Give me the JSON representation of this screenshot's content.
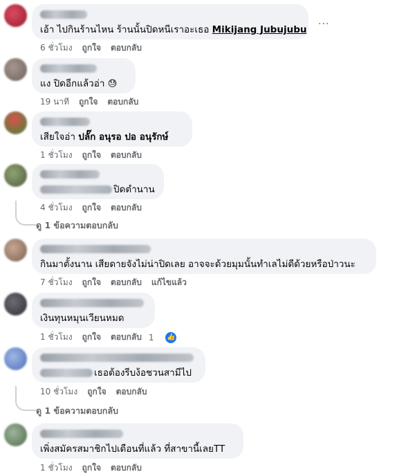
{
  "comments": [
    {
      "text_pre": "เอ้า ไปกินร้านไหน ร้านนั้นปิดหนีเราอะเธอ ",
      "tag": "Mikijang Jubujubu",
      "time": "6 ชั่วโมง",
      "like": "ถูกใจ",
      "reply": "ตอบกลับ",
      "more": "···",
      "avatar_color": "#b3243a"
    },
    {
      "text": "แง ปิดอีกแล้วอ่า",
      "emoji": "😓",
      "time": "19 นาที",
      "like": "ถูกใจ",
      "reply": "ตอบกลับ",
      "avatar_color": "#8a7c78"
    },
    {
      "text_pre": "เสียใจอ่า ",
      "tag": "ปลั๊ก อนุรอ ปอ อนุรักษ์",
      "time": "1 ชั่วโมง",
      "like": "ถูกใจ",
      "reply": "ตอบกลับ",
      "avatar_color": "#5b9a45"
    },
    {
      "text": "ปิดตำนาน",
      "time": "4 ชั่วโมง",
      "like": "ถูกใจ",
      "reply": "ตอบกลับ",
      "replies": "ดู 1 ข้อความตอบกลับ",
      "avatar_color": "#6b7e58"
    },
    {
      "text": "กินมาตั้งนาน เสียดายจังไม่น่าปิดเลย อาจจะด้วยมุมนั้นทำเลไม่ดีด้วยหรือป่าวนะ",
      "time": "7 ชั่วโมง",
      "like": "ถูกใจ",
      "reply": "ตอบกลับ",
      "edited": "แก้ไขแล้ว",
      "avatar_color": "#a08574"
    },
    {
      "text": "เงินทุนหมุนเวียนหมด",
      "time": "1 ชั่วโมง",
      "like": "ถูกใจ",
      "reply": "ตอบกลับ",
      "reaction_count": "1",
      "avatar_color": "#4a4a52"
    },
    {
      "text": "เธอต้องรีบง้อชวนสามีไป",
      "time": "10 ชั่วโมง",
      "like": "ถูกใจ",
      "reply": "ตอบกลับ",
      "replies": "ดู 1 ข้อความตอบกลับ",
      "avatar_color": "#5d80c4"
    },
    {
      "text": "เพิ่งสมัครสมาชิกไปเดือนที่แล้ว ที่สาขานี้เลยTT",
      "time": "1 ชั่วโมง",
      "like": "ถูกใจ",
      "reply": "ตอบกลับ",
      "avatar_color": "#6d8a6a"
    }
  ]
}
